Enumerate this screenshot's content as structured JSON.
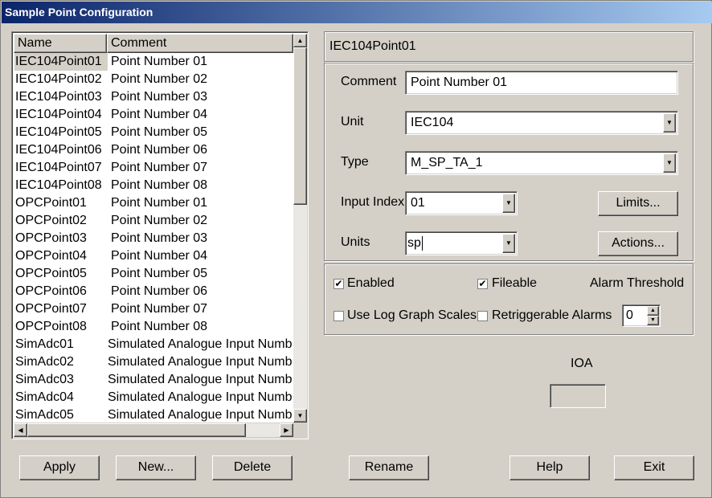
{
  "window": {
    "title": "Sample Point Configuration"
  },
  "list": {
    "columns": [
      "Name",
      "Comment"
    ],
    "rows": [
      {
        "name": "IEC104Point01",
        "comment": "Point Number 01"
      },
      {
        "name": "IEC104Point02",
        "comment": "Point Number 02"
      },
      {
        "name": "IEC104Point03",
        "comment": "Point Number 03"
      },
      {
        "name": "IEC104Point04",
        "comment": "Point Number 04"
      },
      {
        "name": "IEC104Point05",
        "comment": "Point Number 05"
      },
      {
        "name": "IEC104Point06",
        "comment": "Point Number 06"
      },
      {
        "name": "IEC104Point07",
        "comment": "Point Number 07"
      },
      {
        "name": "IEC104Point08",
        "comment": "Point Number 08"
      },
      {
        "name": "OPCPoint01",
        "comment": "Point Number 01"
      },
      {
        "name": "OPCPoint02",
        "comment": "Point Number 02"
      },
      {
        "name": "OPCPoint03",
        "comment": "Point Number 03"
      },
      {
        "name": "OPCPoint04",
        "comment": "Point Number 04"
      },
      {
        "name": "OPCPoint05",
        "comment": "Point Number 05"
      },
      {
        "name": "OPCPoint06",
        "comment": "Point Number 06"
      },
      {
        "name": "OPCPoint07",
        "comment": "Point Number 07"
      },
      {
        "name": "OPCPoint08",
        "comment": "Point Number 08"
      },
      {
        "name": "SimAdc01",
        "comment": "Simulated Analogue Input Numb"
      },
      {
        "name": "SimAdc02",
        "comment": "Simulated Analogue Input Numb"
      },
      {
        "name": "SimAdc03",
        "comment": "Simulated Analogue Input Numb"
      },
      {
        "name": "SimAdc04",
        "comment": "Simulated Analogue Input Numb"
      },
      {
        "name": "SimAdc05",
        "comment": "Simulated Analogue Input Numb"
      }
    ]
  },
  "detail": {
    "point_name": "IEC104Point01",
    "comment_label": "Comment",
    "comment_value": "Point Number 01",
    "unit_label": "Unit",
    "unit_value": "IEC104",
    "type_label": "Type",
    "type_value": "M_SP_TA_1",
    "input_index_label": "Input Index",
    "input_index_value": "01",
    "units_label": "Units",
    "units_value": "sp",
    "limits_button": "Limits...",
    "actions_button": "Actions..."
  },
  "flags": {
    "enabled_label": "Enabled",
    "enabled_checked": true,
    "fileable_label": "Fileable",
    "fileable_checked": true,
    "alarm_threshold_label": "Alarm Threshold",
    "log_graph_label": "Use Log Graph Scales",
    "log_graph_checked": false,
    "retrigger_label": "Retriggerable Alarms",
    "retrigger_checked": false,
    "alarm_threshold_value": "0"
  },
  "ioa": {
    "label": "IOA",
    "value": ""
  },
  "buttons": {
    "apply": "Apply",
    "new": "New...",
    "delete": "Delete",
    "rename": "Rename",
    "help": "Help",
    "exit": "Exit"
  }
}
